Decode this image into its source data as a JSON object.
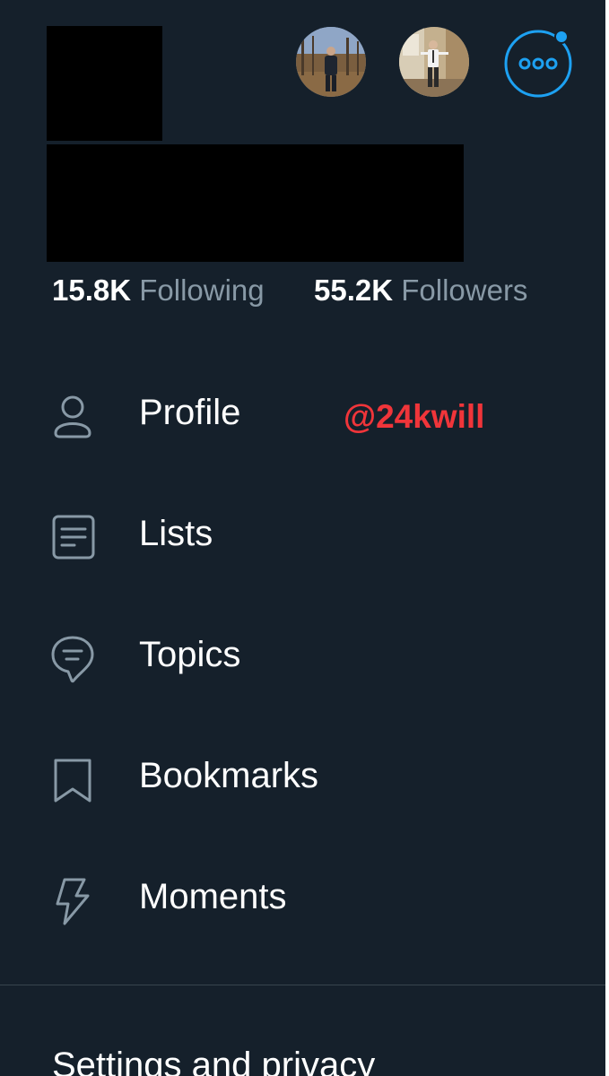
{
  "stats": {
    "following_count": "15.8K",
    "following_label": "Following",
    "followers_count": "55.2K",
    "followers_label": "Followers"
  },
  "menu": {
    "profile": "Profile",
    "lists": "Lists",
    "topics": "Topics",
    "bookmarks": "Bookmarks",
    "moments": "Moments"
  },
  "annotation": "@24kwill",
  "settings_label": "Settings and privacy",
  "icons": {
    "more": "more-options-icon",
    "profile": "person-icon",
    "lists": "list-icon",
    "topics": "topics-icon",
    "bookmarks": "bookmark-icon",
    "moments": "lightning-icon"
  },
  "colors": {
    "background": "#15202b",
    "primary_text": "#ffffff",
    "secondary_text": "#8899a6",
    "icon": "#8899a6",
    "accent": "#1da1f2",
    "annotation": "#f0353a",
    "divider": "#38444d"
  }
}
